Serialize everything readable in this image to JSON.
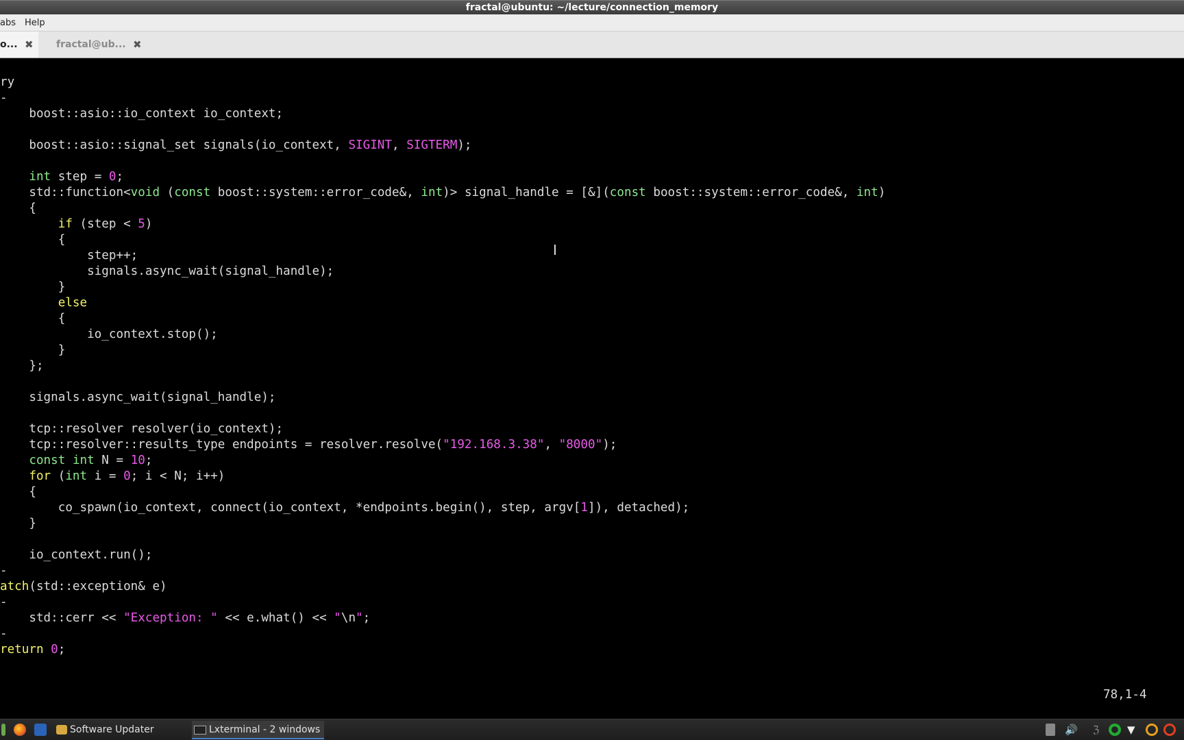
{
  "window": {
    "title": "fractal@ubuntu: ~/lecture/connection_memory"
  },
  "menu": {
    "tabs": "abs",
    "help": "Help"
  },
  "tabs": [
    {
      "label": "o...",
      "close": "✖"
    },
    {
      "label": "fractal@ub...",
      "close": "✖"
    }
  ],
  "status": {
    "position": "78,1-4"
  },
  "taskbar": {
    "software_updater": "Software Updater",
    "lxterminal": "Lxterminal - 2 windows"
  },
  "colors": {
    "keyword": "#f2f26a",
    "type": "#8ee88e",
    "literal": "#e85ae8",
    "text": "#dcdcdc",
    "background": "#000000"
  },
  "code_lines": [
    [
      [
        "t",
        "ry"
      ]
    ],
    [
      [
        "t",
        "-"
      ]
    ],
    [
      [
        "t",
        "    boost::asio::io_context io_context;"
      ]
    ],
    [
      [
        "t",
        ""
      ]
    ],
    [
      [
        "t",
        "    boost::asio::signal_set signals(io_context, "
      ],
      [
        "n",
        "SIGINT"
      ],
      [
        "t",
        ", "
      ],
      [
        "n",
        "SIGTERM"
      ],
      [
        "t",
        ");"
      ]
    ],
    [
      [
        "t",
        ""
      ]
    ],
    [
      [
        "t",
        "    "
      ],
      [
        "y",
        "int"
      ],
      [
        "t",
        " step = "
      ],
      [
        "n",
        "0"
      ],
      [
        "t",
        ";"
      ]
    ],
    [
      [
        "t",
        "    std::function<"
      ],
      [
        "y",
        "void"
      ],
      [
        "t",
        " ("
      ],
      [
        "y",
        "const"
      ],
      [
        "t",
        " boost::system::error_code&, "
      ],
      [
        "y",
        "int"
      ],
      [
        "t",
        ")> signal_handle = [&]("
      ],
      [
        "y",
        "const"
      ],
      [
        "t",
        " boost::system::error_code&, "
      ],
      [
        "y",
        "int"
      ],
      [
        "t",
        ")"
      ]
    ],
    [
      [
        "t",
        "    {"
      ]
    ],
    [
      [
        "t",
        "        "
      ],
      [
        "k",
        "if"
      ],
      [
        "t",
        " (step < "
      ],
      [
        "n",
        "5"
      ],
      [
        "t",
        ")"
      ]
    ],
    [
      [
        "t",
        "        {"
      ]
    ],
    [
      [
        "t",
        "            step++;"
      ]
    ],
    [
      [
        "t",
        "            signals.async_wait(signal_handle);"
      ]
    ],
    [
      [
        "t",
        "        }"
      ]
    ],
    [
      [
        "t",
        "        "
      ],
      [
        "k",
        "else"
      ]
    ],
    [
      [
        "t",
        "        {"
      ]
    ],
    [
      [
        "t",
        "            io_context.stop();"
      ]
    ],
    [
      [
        "t",
        "        }"
      ]
    ],
    [
      [
        "t",
        "    };"
      ]
    ],
    [
      [
        "t",
        ""
      ]
    ],
    [
      [
        "t",
        "    signals.async_wait(signal_handle);"
      ]
    ],
    [
      [
        "t",
        ""
      ]
    ],
    [
      [
        "t",
        "    tcp::resolver resolver(io_context);"
      ]
    ],
    [
      [
        "t",
        "    tcp::resolver::results_type endpoints = resolver.resolve("
      ],
      [
        "n",
        "\"192.168.3.38\""
      ],
      [
        "t",
        ", "
      ],
      [
        "n",
        "\"8000\""
      ],
      [
        "t",
        ");"
      ]
    ],
    [
      [
        "t",
        "    "
      ],
      [
        "y",
        "const"
      ],
      [
        "t",
        " "
      ],
      [
        "y",
        "int"
      ],
      [
        "t",
        " N = "
      ],
      [
        "n",
        "10"
      ],
      [
        "t",
        ";"
      ]
    ],
    [
      [
        "t",
        "    "
      ],
      [
        "k",
        "for"
      ],
      [
        "t",
        " ("
      ],
      [
        "y",
        "int"
      ],
      [
        "t",
        " i = "
      ],
      [
        "n",
        "0"
      ],
      [
        "t",
        "; i < N; i++)"
      ]
    ],
    [
      [
        "t",
        "    {"
      ]
    ],
    [
      [
        "t",
        "        co_spawn(io_context, connect(io_context, *endpoints.begin(), step, argv["
      ],
      [
        "n",
        "1"
      ],
      [
        "t",
        "]), detached);"
      ]
    ],
    [
      [
        "t",
        "    }"
      ]
    ],
    [
      [
        "t",
        ""
      ]
    ],
    [
      [
        "t",
        "    io_context.run();"
      ]
    ],
    [
      [
        "t",
        "-"
      ]
    ],
    [
      [
        "k",
        "atch"
      ],
      [
        "t",
        "(std::exception& e)"
      ]
    ],
    [
      [
        "t",
        "-"
      ]
    ],
    [
      [
        "t",
        "    std::cerr << "
      ],
      [
        "n",
        "\"Exception: \""
      ],
      [
        "t",
        " << e.what() << "
      ],
      [
        "n",
        "\""
      ],
      [
        "t",
        "\\n"
      ],
      [
        "n",
        "\""
      ],
      [
        "t",
        ";"
      ]
    ],
    [
      [
        "t",
        "-"
      ]
    ],
    [
      [
        "k",
        "return"
      ],
      [
        "t",
        " "
      ],
      [
        "n",
        "0"
      ],
      [
        "t",
        ";"
      ]
    ]
  ]
}
